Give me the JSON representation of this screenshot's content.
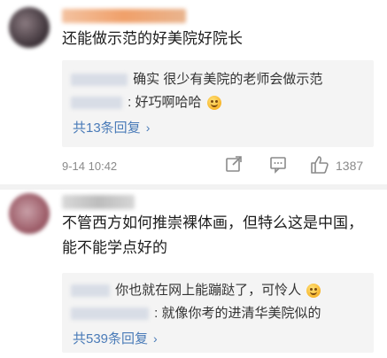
{
  "comments": [
    {
      "text": "还能做示范的好美院好院长",
      "replies": [
        {
          "text": "确实 很少有美院的老师会做示范",
          "emoji": ""
        },
        {
          "text": ": 好巧啊哈哈",
          "emoji": "grinning-emoji"
        }
      ],
      "more_replies": "共13条回复",
      "time": "9-14 10:42",
      "like_count": "1387"
    },
    {
      "text": "不管西方如何推崇裸体画，但特么这是中国，能不能学点好的",
      "replies": [
        {
          "text": "你也就在网上能蹦跶了，可怜人",
          "emoji": "smiling-emoji"
        },
        {
          "text": ": 就像你考的进清华美院似的",
          "emoji": ""
        }
      ],
      "more_replies": "共539条回复"
    }
  ],
  "chevron": "›",
  "icons": [
    "share-icon",
    "comment-icon",
    "like-icon",
    "chevron-right-icon"
  ]
}
